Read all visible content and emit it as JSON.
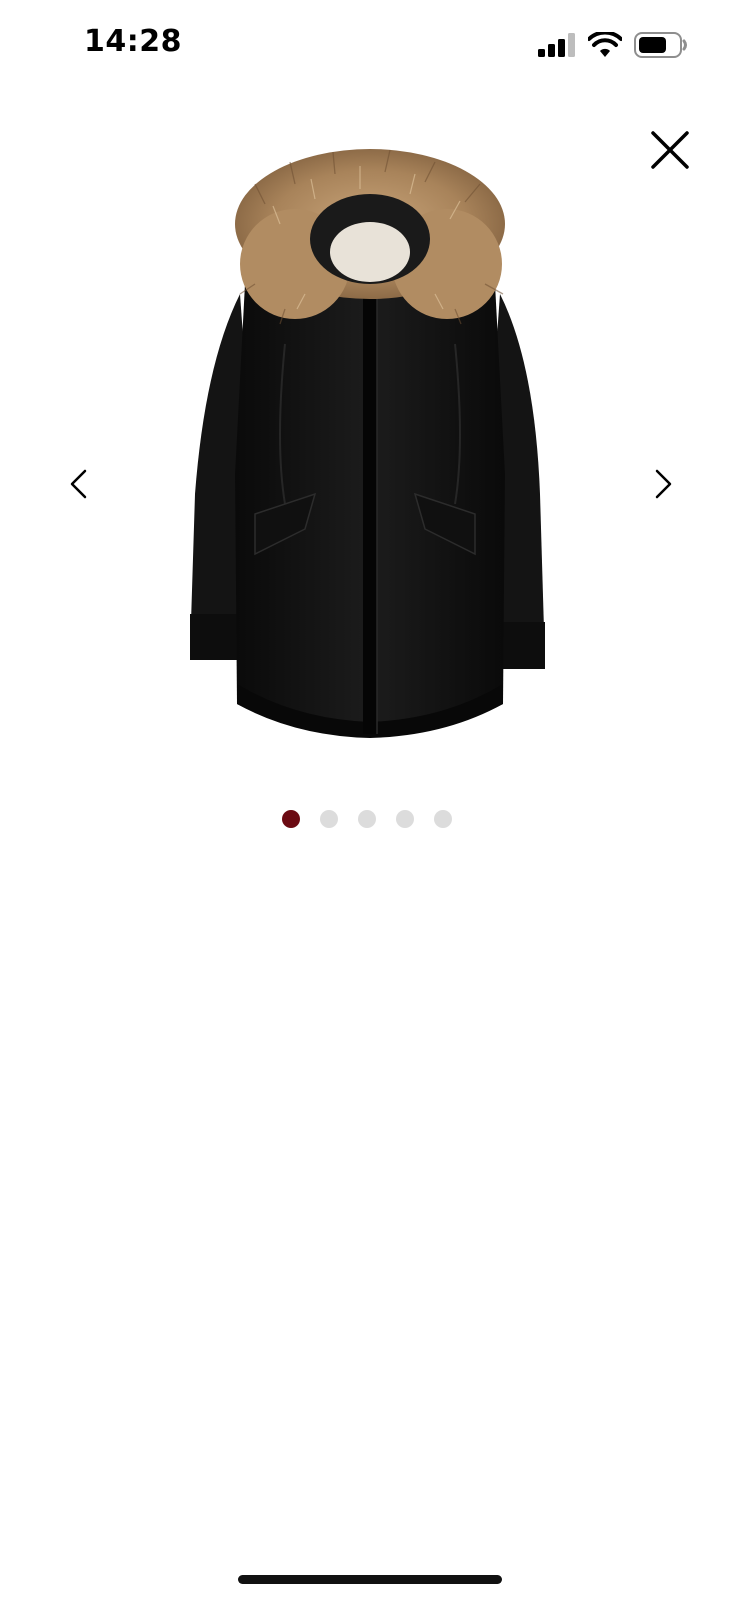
{
  "status_bar": {
    "time": "14:28",
    "signal_icon": "cellular-signal-icon",
    "wifi_icon": "wifi-icon",
    "battery_icon": "battery-icon"
  },
  "viewer": {
    "close_icon": "close-icon",
    "prev_icon": "chevron-left-icon",
    "next_icon": "chevron-right-icon",
    "image_alt": "parka-with-fur-hood",
    "current_index": 1,
    "total_images": 5,
    "colors": {
      "active_dot": "#6b0a12",
      "inactive_dot": "#dcdcdc"
    }
  }
}
